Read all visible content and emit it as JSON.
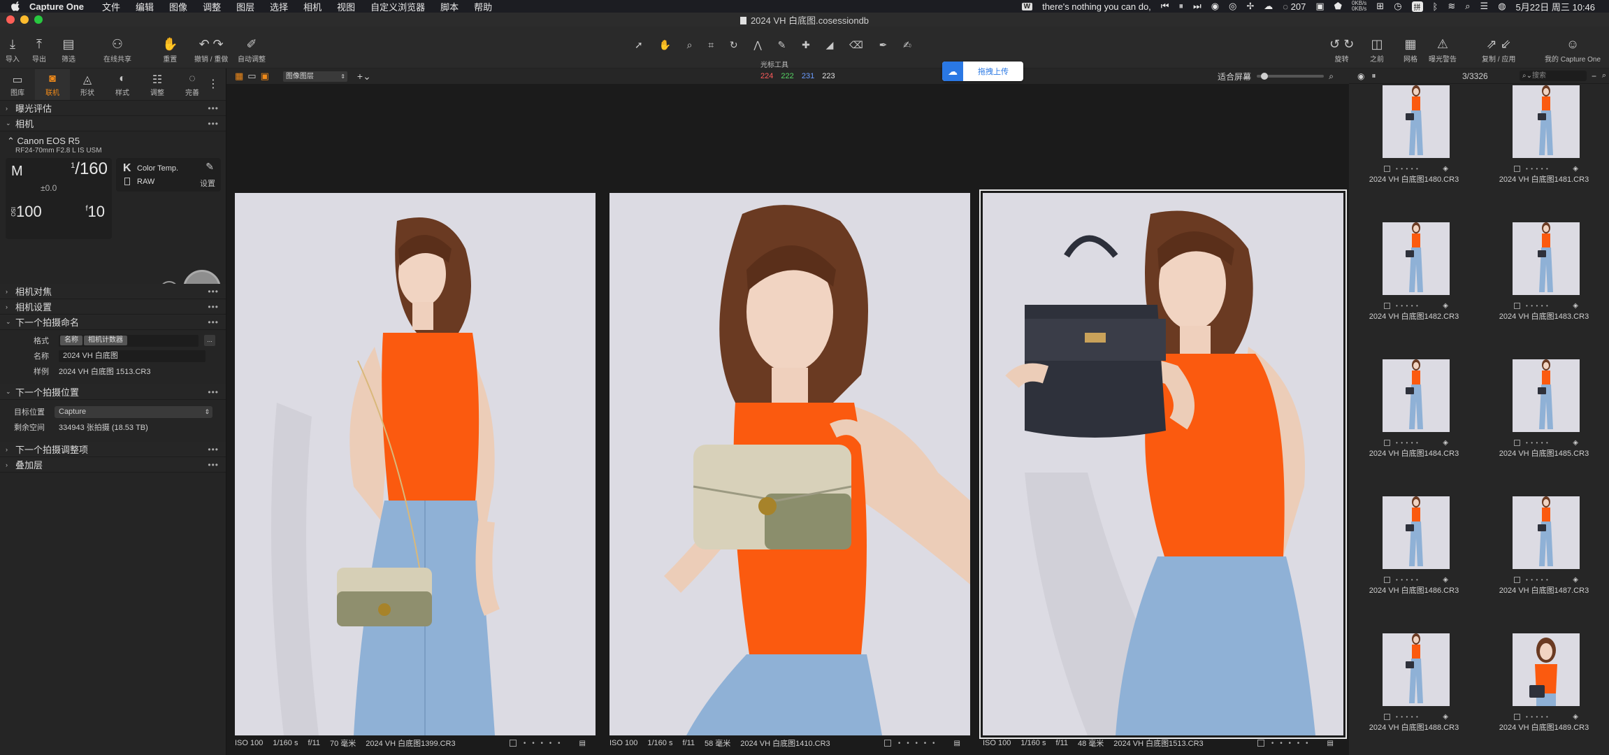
{
  "menubar": {
    "app_name": "Capture One",
    "items": [
      "文件",
      "编辑",
      "图像",
      "调整",
      "图层",
      "选择",
      "相机",
      "视图",
      "自定义浏览器",
      "脚本",
      "帮助"
    ],
    "now_playing": "there's nothing you can do,",
    "notification_count": "207",
    "net_up": "0KB/s",
    "net_down": "0KB/s",
    "ime": "拼",
    "clock": "5月22日 周三  10:46"
  },
  "window": {
    "title": "2024 VH 白底图.cosessiondb"
  },
  "toolbar": {
    "left_buttons": [
      {
        "label": "导入",
        "icon": "import-icon"
      },
      {
        "label": "导出",
        "icon": "export-icon"
      },
      {
        "label": "筛选",
        "icon": "filter-icon"
      },
      {
        "label": "在线共享",
        "icon": "share-people-icon"
      },
      {
        "label": "重置",
        "icon": "reset-hand-icon"
      },
      {
        "label": "撤销 / 重做",
        "icon": "undo-redo-icon"
      },
      {
        "label": "自动调整",
        "icon": "magic-wand-icon"
      }
    ],
    "cursor_tools_label": "光标工具",
    "right_buttons": [
      {
        "label": "旋转",
        "icon": "rotate-icon"
      },
      {
        "label": "之前",
        "icon": "before-after-icon"
      },
      {
        "label": "网格",
        "icon": "grid-icon"
      },
      {
        "label": "曝光警告",
        "icon": "exposure-warning-icon"
      },
      {
        "label": "复制 / 应用",
        "icon": "copy-apply-icon"
      },
      {
        "label": "我的 Capture One",
        "icon": "user-icon"
      }
    ]
  },
  "left_panel": {
    "tabs": [
      {
        "label": "图库",
        "icon": "folder-icon",
        "active": false
      },
      {
        "label": "联机",
        "icon": "camera-tether-icon",
        "active": true
      },
      {
        "label": "形状",
        "icon": "shape-icon",
        "active": false
      },
      {
        "label": "样式",
        "icon": "style-icon",
        "active": false
      },
      {
        "label": "调整",
        "icon": "sliders-icon",
        "active": false
      },
      {
        "label": "完善",
        "icon": "refine-icon",
        "active": false
      }
    ],
    "sections": {
      "exposure": "曝光评估",
      "camera": "相机",
      "focus": "相机对焦",
      "settings": "相机设置",
      "naming": "下一个拍摄命名",
      "location": "下一个拍摄位置",
      "adjustments": "下一个拍摄调整项",
      "overlay": "叠加层"
    },
    "camera": {
      "model": "Canon EOS R5",
      "lens": "RF24-70mm F2.8 L IS USM",
      "mode": "M",
      "shutter_num": "1",
      "shutter_den": "160",
      "ev": "±0.0",
      "iso": "100",
      "aperture_prefix": "f",
      "aperture": "10",
      "color_temp_key": "K",
      "color_temp_label": "Color Temp.",
      "format": "RAW",
      "settings_label": "设置"
    },
    "naming": {
      "format_label": "格式",
      "format_chips": [
        "名称",
        "相机计数器"
      ],
      "more": "...",
      "name_label": "名称",
      "name_value": "2024 VH 白底图",
      "sample_label": "样例",
      "sample_value": "2024 VH 白底图 1513.CR3"
    },
    "location": {
      "target_label": "目标位置",
      "target_value": "Capture",
      "space_label": "剩余空间",
      "space_value": "334943 张拍摄 (18.53 TB)"
    }
  },
  "viewer": {
    "layer_select": "图像图层",
    "rgb": {
      "r": "224",
      "g": "222",
      "b": "231",
      "l": "223"
    },
    "fit_label": "适合屏幕",
    "upload_label": "拖拽上传",
    "images": [
      {
        "iso": "ISO 100",
        "shutter": "1/160 s",
        "aperture": "f/11",
        "focal": "70 毫米",
        "name": "2024 VH 白底图1399.CR3",
        "selected": false
      },
      {
        "iso": "ISO 100",
        "shutter": "1/160 s",
        "aperture": "f/11",
        "focal": "58 毫米",
        "name": "2024 VH 白底图1410.CR3",
        "selected": false
      },
      {
        "iso": "ISO 100",
        "shutter": "1/160 s",
        "aperture": "f/11",
        "focal": "48 毫米",
        "name": "2024 VH 白底图1513.CR3",
        "selected": true
      }
    ]
  },
  "browser": {
    "count": "3/3326",
    "search_placeholder": "搜索",
    "thumbs": [
      "2024 VH 白底图1480.CR3",
      "2024 VH 白底图1481.CR3",
      "2024 VH 白底图1482.CR3",
      "2024 VH 白底图1483.CR3",
      "2024 VH 白底图1484.CR3",
      "2024 VH 白底图1485.CR3",
      "2024 VH 白底图1486.CR3",
      "2024 VH 白底图1487.CR3",
      "2024 VH 白底图1488.CR3",
      "2024 VH 白底图1489.CR3"
    ]
  },
  "colors": {
    "accent": "#f08a1a",
    "top_orange": "#fb5a0f",
    "denim": "#8fb1d6",
    "backdrop": "#dcdbe3",
    "hair": "#6a3a22"
  }
}
